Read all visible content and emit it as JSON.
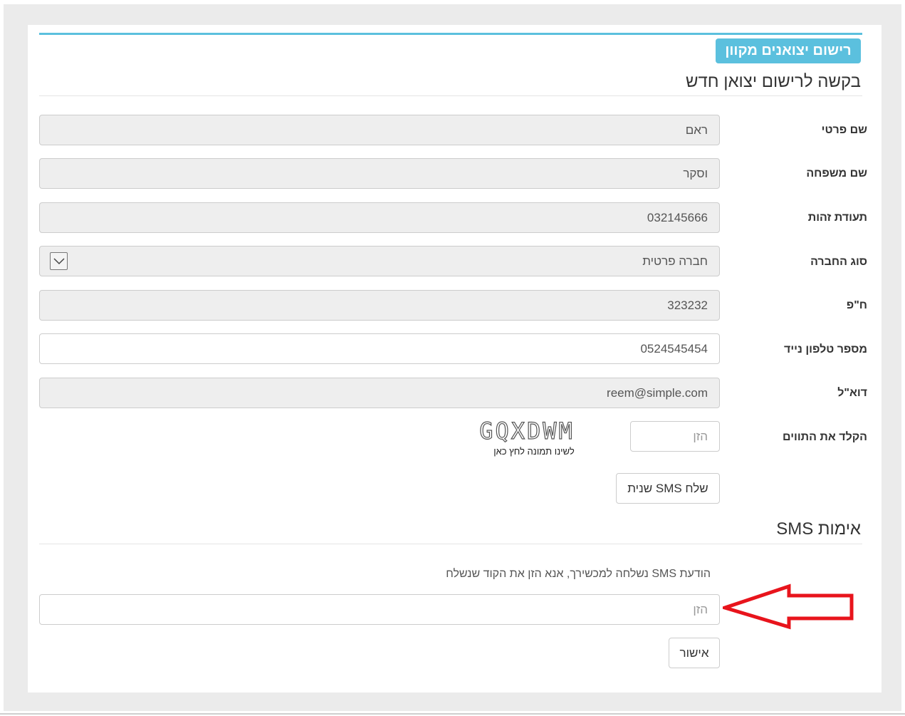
{
  "header": {
    "badge": "רישום יצואנים מקוון",
    "title": "בקשה לרישום יצואן חדש"
  },
  "form": {
    "first_name": {
      "label": "שם פרטי",
      "value": "ראם"
    },
    "last_name": {
      "label": "שם משפחה",
      "value": "וסקר"
    },
    "id_number": {
      "label": "תעודת זהות",
      "value": "032145666"
    },
    "company_type": {
      "label": "סוג החברה",
      "value": "חברה פרטית"
    },
    "company_id": {
      "label": "ח\"פ",
      "value": "323232"
    },
    "mobile": {
      "label": "מספר טלפון נייד",
      "value": "0524545454"
    },
    "email": {
      "label": "דוא\"ל",
      "value": "reem@simple.com"
    },
    "captcha": {
      "label": "הקלד את התווים",
      "placeholder": "הזן",
      "image_text": "GQXDWM",
      "hint": "לשינו תמונה לחץ כאן"
    },
    "resend_sms_button": "שלח SMS שנית"
  },
  "sms_verification": {
    "title": "אימות SMS",
    "message": "הודעת SMS נשלחה למכשירך, אנא הזן את הקוד שנשלח",
    "placeholder": "הזן",
    "confirm_button": "אישור"
  },
  "colors": {
    "accent": "#5bc0de",
    "annotation_arrow": "#e8141c",
    "readonly_field": "#eeeeee"
  }
}
